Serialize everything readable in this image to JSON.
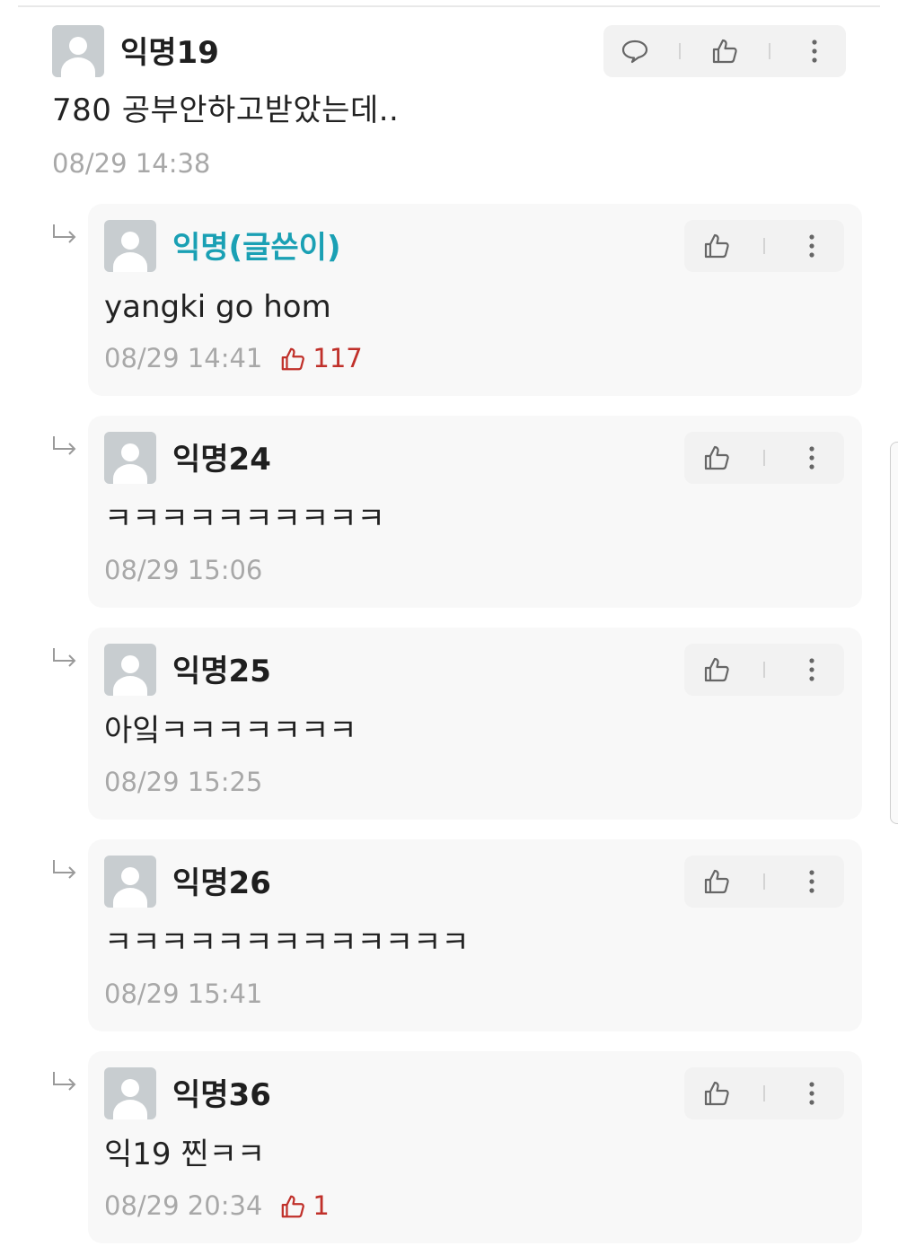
{
  "main_comment": {
    "author": "익명19",
    "text": "780  공부안하고받았는데..",
    "timestamp": "08/29 14:38",
    "actions": [
      "reply-icon",
      "thumbs-up-icon",
      "more-vertical-icon"
    ]
  },
  "replies": [
    {
      "author": "익명(글쓴이)",
      "is_author": true,
      "text": "yangki go hom",
      "timestamp": "08/29 14:41",
      "likes": "117"
    },
    {
      "author": "익명24",
      "is_author": false,
      "text": "ㅋㅋㅋㅋㅋㅋㅋㅋㅋㅋ",
      "timestamp": "08/29 15:06",
      "likes": null
    },
    {
      "author": "익명25",
      "is_author": false,
      "text": "아잌ㅋㅋㅋㅋㅋㅋㅋ",
      "timestamp": "08/29 15:25",
      "likes": null
    },
    {
      "author": "익명26",
      "is_author": false,
      "text": "ㅋㅋㅋㅋㅋㅋㅋㅋㅋㅋㅋㅋㅋ",
      "timestamp": "08/29 15:41",
      "likes": null
    },
    {
      "author": "익명36",
      "is_author": false,
      "text": "익19 찐ㅋㅋ",
      "timestamp": "08/29 20:34",
      "likes": "1"
    }
  ],
  "colors": {
    "author_accent": "#1aa0b4",
    "like_red": "#c0302a",
    "meta_gray": "#a8a8a8",
    "reply_bg": "#f8f8f8",
    "action_bg": "#f2f2f2"
  }
}
